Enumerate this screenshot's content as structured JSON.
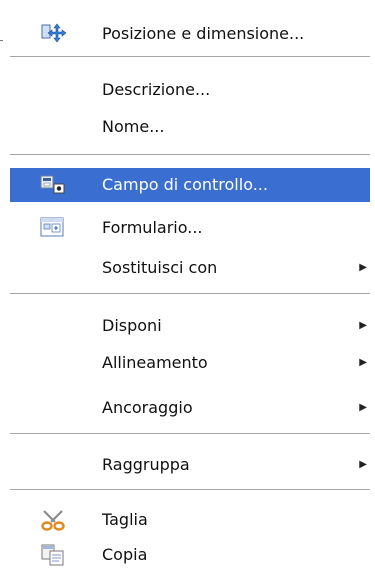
{
  "menu": {
    "items": [
      {
        "label": "Posizione e dimensione...",
        "icon": "move-arrows-icon",
        "submenu": false
      },
      {
        "label": "Descrizione...",
        "icon": "",
        "submenu": false
      },
      {
        "label": "Nome...",
        "icon": "",
        "submenu": false
      },
      {
        "label": "Campo di controllo...",
        "icon": "form-control-icon",
        "submenu": false,
        "selected": true
      },
      {
        "label": "Formulario...",
        "icon": "form-icon",
        "submenu": false
      },
      {
        "label": "Sostituisci con",
        "icon": "",
        "submenu": true
      },
      {
        "label": "Disponi",
        "icon": "",
        "submenu": true
      },
      {
        "label": "Allineamento",
        "icon": "",
        "submenu": true
      },
      {
        "label": "Ancoraggio",
        "icon": "",
        "submenu": true
      },
      {
        "label": "Raggruppa",
        "icon": "",
        "submenu": true
      },
      {
        "label": "Taglia",
        "icon": "scissors-icon",
        "submenu": false
      },
      {
        "label": "Copia",
        "icon": "copy-icon",
        "submenu": false
      }
    ],
    "submenu_arrow": "▶",
    "accent": "#3a6fd1"
  }
}
